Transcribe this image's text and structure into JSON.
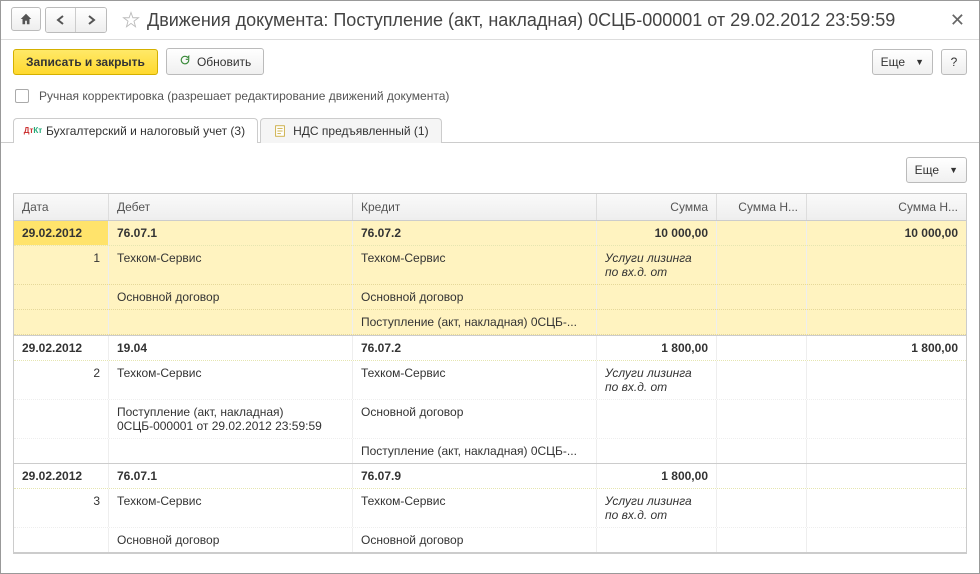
{
  "title": "Движения документа: Поступление (акт, накладная) 0СЦБ-000001 от 29.02.2012 23:59:59",
  "toolbar": {
    "save_close": "Записать и закрыть",
    "refresh": "Обновить",
    "more": "Еще",
    "help": "?"
  },
  "manual_edit_label": "Ручная корректировка (разрешает редактирование движений документа)",
  "tabs": {
    "accounting": "Бухгалтерский и налоговый учет (3)",
    "vat": "НДС предъявленный (1)"
  },
  "content_more": "Еще",
  "columns": {
    "date": "Дата",
    "debit": "Дебет",
    "credit": "Кредит",
    "sum": "Сумма",
    "sum_n1": "Сумма Н...",
    "sum_n2": "Сумма Н..."
  },
  "entries": [
    {
      "selected": true,
      "date": "29.02.2012",
      "idx": "1",
      "debit_acc": "76.07.1",
      "credit_acc": "76.07.2",
      "sum": "10 000,00",
      "sum_n2": "10 000,00",
      "note": "Услуги лизинга по вх.д.  от",
      "debit_lines": [
        "Техком-Сервис",
        "Основной договор",
        ""
      ],
      "credit_lines": [
        "Техком-Сервис",
        "Основной договор",
        "Поступление (акт, накладная) 0СЦБ-..."
      ]
    },
    {
      "date": "29.02.2012",
      "idx": "2",
      "debit_acc": "19.04",
      "credit_acc": "76.07.2",
      "sum": "1 800,00",
      "sum_n2": "1 800,00",
      "note": "Услуги лизинга по вх.д.  от",
      "debit_lines": [
        "Техком-Сервис",
        "Поступление (акт, накладная) 0СЦБ-000001 от 29.02.2012 23:59:59",
        ""
      ],
      "credit_lines": [
        "Техком-Сервис",
        "Основной договор",
        "Поступление (акт, накладная) 0СЦБ-..."
      ]
    },
    {
      "date": "29.02.2012",
      "idx": "3",
      "debit_acc": "76.07.1",
      "credit_acc": "76.07.9",
      "sum": "1 800,00",
      "sum_n2": "",
      "note": "Услуги лизинга по вх.д.  от",
      "debit_lines": [
        "Техком-Сервис",
        "Основной договор"
      ],
      "credit_lines": [
        "Техком-Сервис",
        "Основной договор"
      ]
    }
  ]
}
